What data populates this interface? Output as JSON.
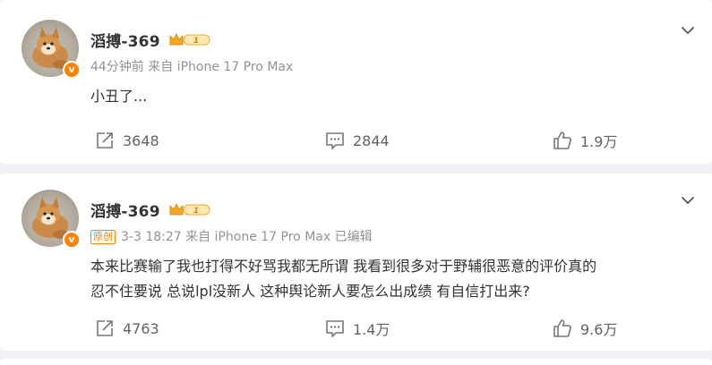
{
  "posts": [
    {
      "author": "滔搏-369",
      "level": "1",
      "verified_mark": "v",
      "meta": "44分钟前  来自 iPhone 17 Pro Max",
      "original_tag": "",
      "text_lines": [
        "小丑了..."
      ],
      "repost_count": "3648",
      "comment_count": "2844",
      "like_count": "1.9万"
    },
    {
      "author": "滔搏-369",
      "level": "1",
      "verified_mark": "v",
      "meta": "3-3 18:27  来自 iPhone 17 Pro Max 已编辑",
      "original_tag": "原创",
      "text_lines": [
        "本来比赛输了我也打得不好骂我都无所谓  我看到很多对于野辅很恶意的评价真的",
        "忍不住要说 总说lpl没新人 这种舆论新人要怎么出成绩 有自信打出来?"
      ],
      "repost_count": "4763",
      "comment_count": "1.4万",
      "like_count": "9.6万"
    }
  ],
  "colors": {
    "page_bg": "#f0f1f4",
    "card_bg": "#ffffff",
    "text": "#333333",
    "meta": "#939393",
    "action": "#636363",
    "accent": "#ff8200",
    "level_badge": "#f5a623"
  },
  "icons": {
    "repost": "repost-icon",
    "comment": "comment-icon",
    "like": "thumbs-up-icon",
    "more": "chevron-down-icon",
    "level": "crown-level-icon",
    "verified": "verified-badge-icon"
  }
}
